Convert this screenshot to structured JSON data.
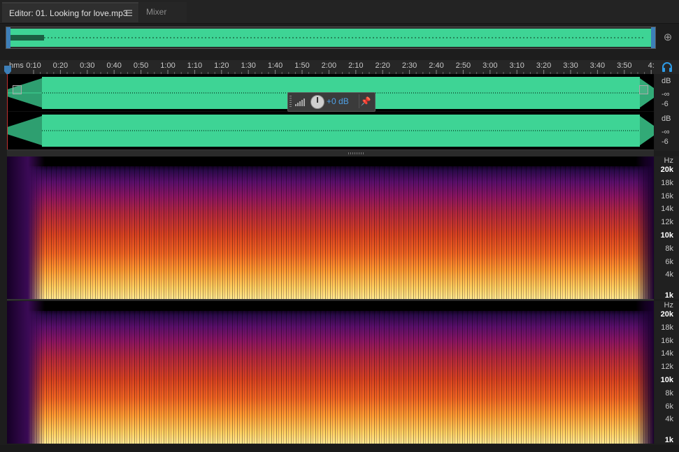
{
  "tabs": {
    "editor_label": "Editor: 01. Looking for love.mp3",
    "editor_menu": "☰",
    "mixer_label": "Mixer"
  },
  "icons": {
    "zoom": "zoom-in-icon",
    "headphone": "headphone-icon",
    "pin": "pin-icon",
    "meter": "level-meter-icon"
  },
  "timeline": {
    "unit": "hms",
    "ticks": [
      "0:10",
      "0:20",
      "0:30",
      "0:40",
      "0:50",
      "1:00",
      "1:10",
      "1:20",
      "1:30",
      "1:40",
      "1:50",
      "2:00",
      "2:10",
      "2:20",
      "2:30",
      "2:40",
      "2:50",
      "3:00",
      "3:10",
      "3:20",
      "3:30",
      "3:40",
      "3:50",
      "4:"
    ]
  },
  "hud": {
    "volume_label": "+0 dB"
  },
  "amplitude_ruler": {
    "ch1": [
      "dB",
      "-∞",
      "-6"
    ],
    "ch2": [
      "dB",
      "-∞",
      "-6"
    ]
  },
  "spectral_ruler": {
    "unit": "Hz",
    "labels": [
      "20k",
      "18k",
      "16k",
      "14k",
      "12k",
      "10k",
      "8k",
      "6k",
      "4k",
      "1k"
    ],
    "bold": [
      "20k",
      "10k",
      "1k"
    ]
  },
  "colors": {
    "waveform": "#3ed495",
    "accent": "#2e9be6",
    "selection": "#3d7fb8"
  }
}
